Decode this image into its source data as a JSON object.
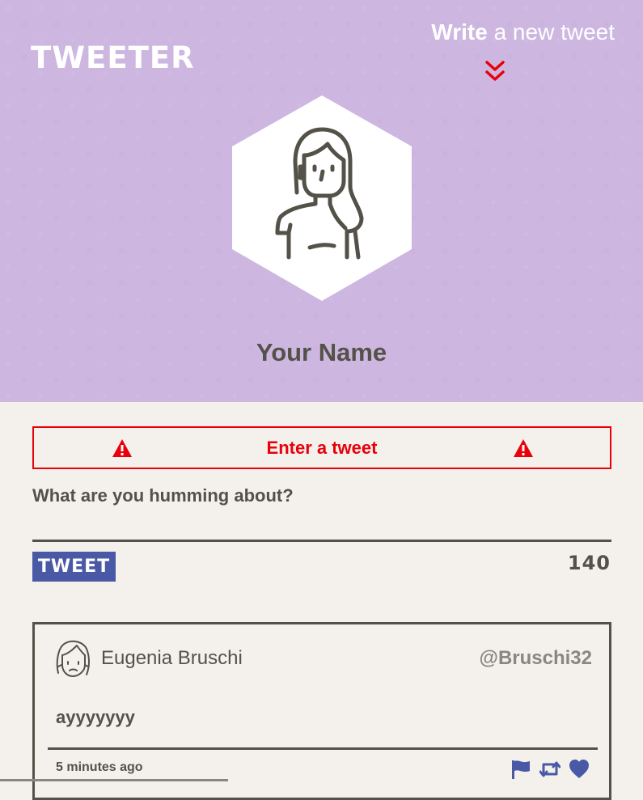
{
  "header": {
    "logo": "TWEETER",
    "compose_bold": "Write",
    "compose_rest": " a new tweet",
    "user_name": "Your Name",
    "background_color": "#cdb7e1",
    "avatar_icon": "woman-avatar-icon",
    "chevron_icon": "double-chevron-down-icon"
  },
  "composer": {
    "error_message": "Enter a tweet",
    "warning_icon": "warning-triangle-icon",
    "question": "What are you humming about?",
    "input_value": "",
    "submit_label": "TWEET",
    "counter": "140",
    "accent_color": "#4a59a6",
    "error_color": "#e8000b"
  },
  "tweets": [
    {
      "name": "Eugenia Bruschi",
      "handle": "@Bruschi32",
      "body": "ayyyyyyy",
      "time": "5 minutes ago",
      "avatar_icon": "sad-woman-avatar-icon",
      "actions": [
        "flag-icon",
        "retweet-icon",
        "heart-icon"
      ]
    }
  ]
}
